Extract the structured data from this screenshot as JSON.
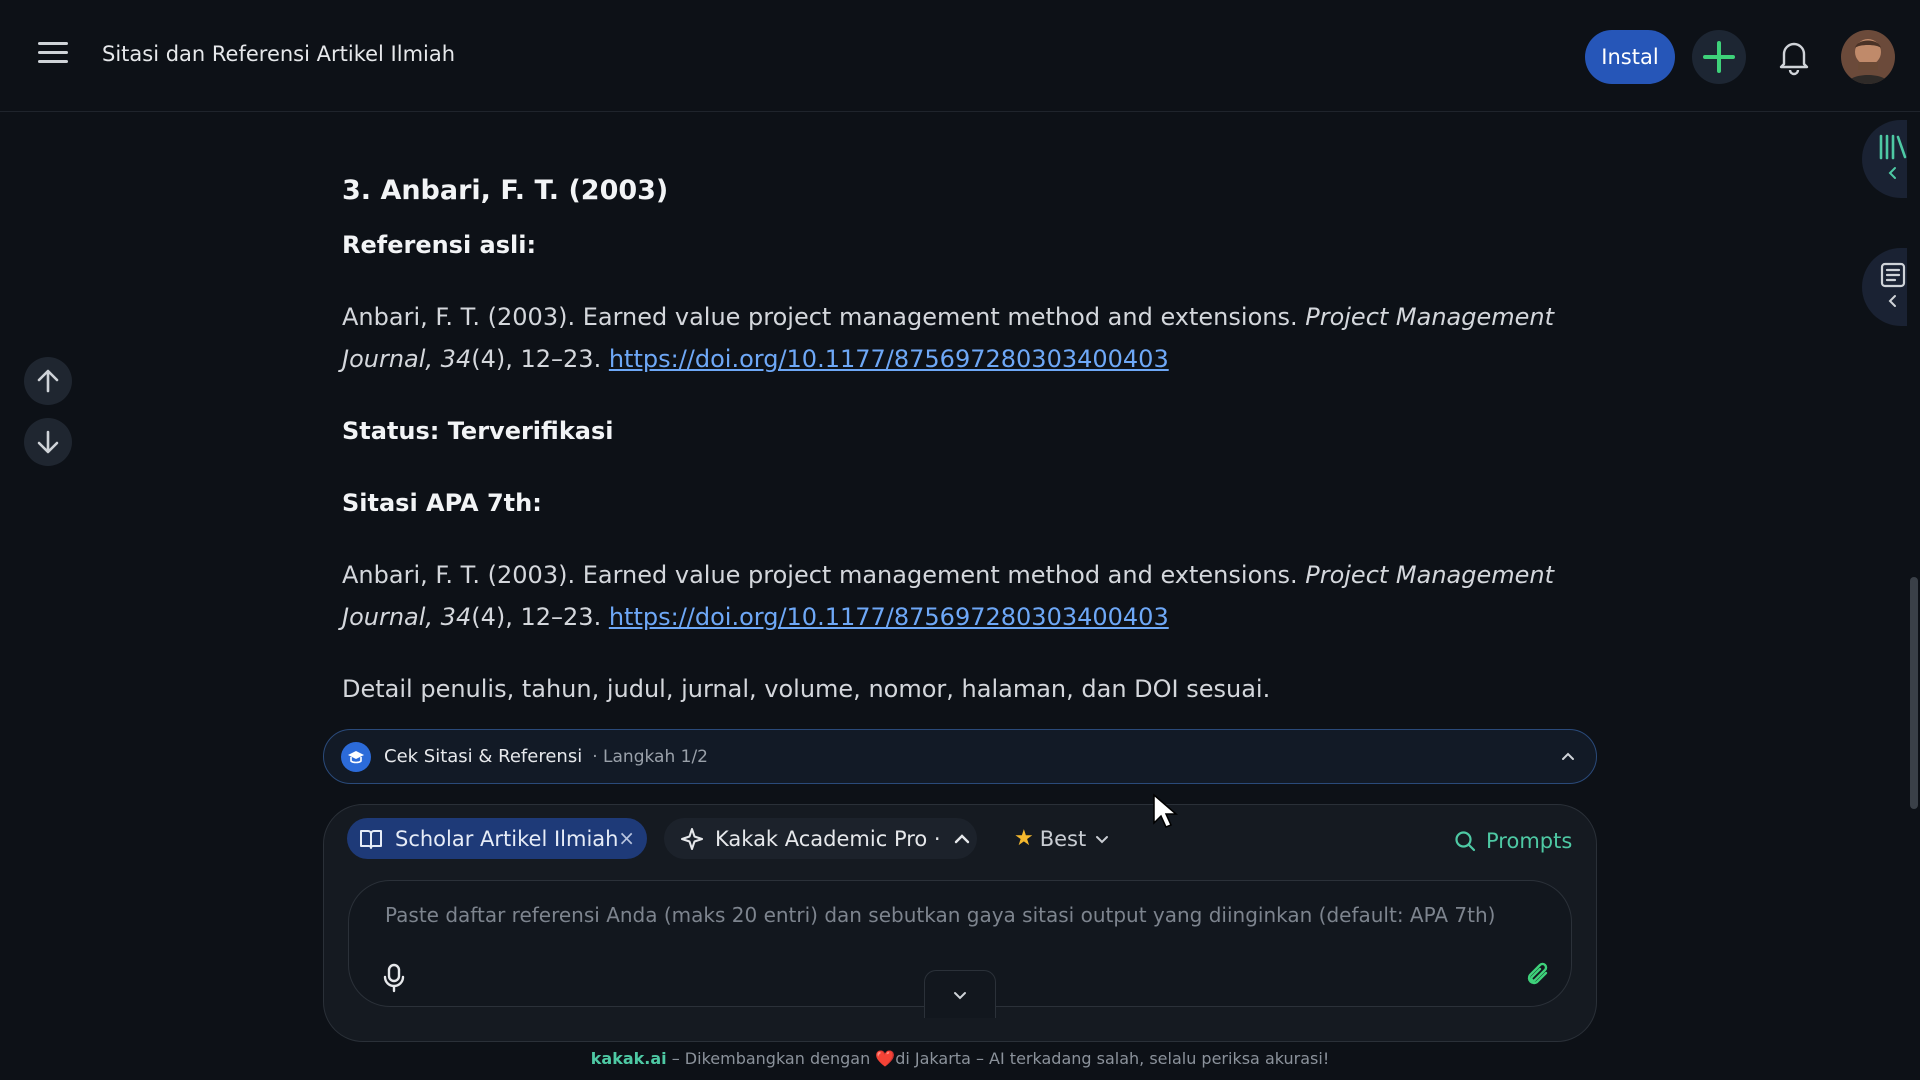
{
  "header": {
    "title": "Sitasi dan Referensi Artikel Ilmiah",
    "install_label": "Instal"
  },
  "article": {
    "heading": "3. Anbari, F. T. (2003)",
    "ref_label": "Referensi asli:",
    "ref_text_pre": "Anbari, F. T. (2003). Earned value project management method and extensions.",
    "ref_journal": "Project Management Journal, 34",
    "ref_issue": "(4), 12–23.",
    "ref_link": "https://doi.org/10.1177/875697280303400403",
    "status": "Status: Terverifikasi",
    "apa_label": "Sitasi APA 7th:",
    "apa_text_pre": "Anbari, F. T. (2003). Earned value project management method and extensions.",
    "apa_journal": "Project Management Journal, 34",
    "apa_issue": "(4), 12–23.",
    "apa_link": "https://doi.org/10.1177/875697280303400403",
    "detail": "Detail penulis, tahun, judul, jurnal, volume, nomor, halaman, dan DOI sesuai."
  },
  "step": {
    "title": "Cek Sitasi & Referensi",
    "progress": "· Langkah 1/2"
  },
  "composer": {
    "chip_scholar": "Scholar Artikel Ilmiah",
    "chip_model": "Kakak Academic Pro ·",
    "chip_best": "Best",
    "prompts": "Prompts",
    "placeholder": "Paste daftar referensi Anda (maks 20 entri) dan sebutkan gaya sitasi output yang diinginkan (default: APA 7th)"
  },
  "footer": {
    "brand": "kakak.ai",
    "text_a": " – Dikembangkan dengan ",
    "heart": "❤️",
    "text_b": "di Jakarta – AI terkadang salah, selalu periksa akurasi!"
  },
  "colors": {
    "accent_blue": "#2656b8",
    "accent_green": "#4ec9a4",
    "link": "#6ea8f7"
  }
}
